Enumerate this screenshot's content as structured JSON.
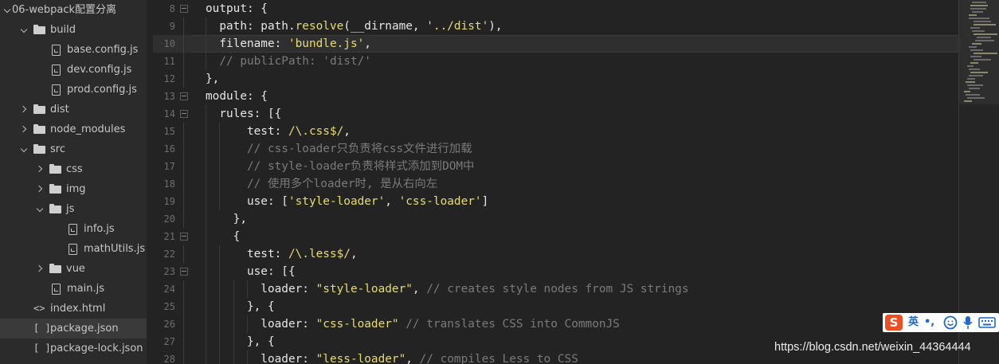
{
  "sidebar": {
    "items": [
      {
        "label": "06-webpack配置分离",
        "type": "folder",
        "state": "open"
      },
      {
        "label": "build",
        "type": "folder",
        "state": "open"
      },
      {
        "label": "base.config.js",
        "type": "file"
      },
      {
        "label": "dev.config.js",
        "type": "file"
      },
      {
        "label": "prod.config.js",
        "type": "file"
      },
      {
        "label": "dist",
        "type": "folder",
        "state": "closed"
      },
      {
        "label": "node_modules",
        "type": "folder",
        "state": "closed"
      },
      {
        "label": "src",
        "type": "folder",
        "state": "open"
      },
      {
        "label": "css",
        "type": "folder",
        "state": "closed"
      },
      {
        "label": "img",
        "type": "folder",
        "state": "closed"
      },
      {
        "label": "js",
        "type": "folder",
        "state": "open"
      },
      {
        "label": "info.js",
        "type": "file"
      },
      {
        "label": "mathUtils.js",
        "type": "file"
      },
      {
        "label": "vue",
        "type": "folder",
        "state": "closed"
      },
      {
        "label": "main.js",
        "type": "file"
      },
      {
        "label": "index.html",
        "type": "html-file",
        "icon_text": "<>"
      },
      {
        "label": "package.json",
        "type": "json-file",
        "icon_text": "[ ]",
        "selected": true
      },
      {
        "label": "package-lock.json",
        "type": "json-file",
        "icon_text": "[ ]"
      }
    ]
  },
  "editor": {
    "current_line": "10",
    "lines": [
      {
        "num": "8",
        "fold": "open",
        "tokens": [
          {
            "t": "output: {",
            "c": "p"
          }
        ]
      },
      {
        "num": "9",
        "tokens": [
          {
            "t": "  path: path.",
            "c": "p"
          },
          {
            "t": "resolve",
            "c": "fn"
          },
          {
            "t": "(__dirname, ",
            "c": "p"
          },
          {
            "t": "'../dist'",
            "c": "str"
          },
          {
            "t": "),",
            "c": "p"
          }
        ]
      },
      {
        "num": "10",
        "tokens": [
          {
            "t": "  filename: ",
            "c": "p"
          },
          {
            "t": "'bundle.js'",
            "c": "str"
          },
          {
            "t": ",",
            "c": "p"
          }
        ]
      },
      {
        "num": "11",
        "tokens": [
          {
            "t": "  // publicPath: 'dist/'",
            "c": "com"
          }
        ]
      },
      {
        "num": "12",
        "tokens": [
          {
            "t": "},",
            "c": "p"
          }
        ]
      },
      {
        "num": "13",
        "fold": "open",
        "tokens": [
          {
            "t": "module: {",
            "c": "p"
          }
        ]
      },
      {
        "num": "14",
        "fold": "open",
        "tokens": [
          {
            "t": "  rules: [{",
            "c": "p"
          }
        ]
      },
      {
        "num": "15",
        "tokens": [
          {
            "t": "      test: ",
            "c": "p"
          },
          {
            "t": "/\\.css$/",
            "c": "str"
          },
          {
            "t": ",",
            "c": "p"
          }
        ]
      },
      {
        "num": "16",
        "tokens": [
          {
            "t": "      // css-loader只负责将css文件进行加载",
            "c": "com"
          }
        ]
      },
      {
        "num": "17",
        "tokens": [
          {
            "t": "      // style-loader负责将样式添加到DOM中",
            "c": "com"
          }
        ]
      },
      {
        "num": "18",
        "tokens": [
          {
            "t": "      // 使用多个loader时, 是从右向左",
            "c": "com"
          }
        ]
      },
      {
        "num": "19",
        "tokens": [
          {
            "t": "      use: [",
            "c": "p"
          },
          {
            "t": "'style-loader'",
            "c": "str"
          },
          {
            "t": ", ",
            "c": "p"
          },
          {
            "t": "'css-loader'",
            "c": "str"
          },
          {
            "t": "]",
            "c": "p"
          }
        ]
      },
      {
        "num": "20",
        "tokens": [
          {
            "t": "    },",
            "c": "p"
          }
        ]
      },
      {
        "num": "21",
        "fold": "open",
        "tokens": [
          {
            "t": "    {",
            "c": "p"
          }
        ]
      },
      {
        "num": "22",
        "tokens": [
          {
            "t": "      test: ",
            "c": "p"
          },
          {
            "t": "/\\.less$/",
            "c": "str"
          },
          {
            "t": ",",
            "c": "p"
          }
        ]
      },
      {
        "num": "23",
        "fold": "open",
        "tokens": [
          {
            "t": "      use: [{",
            "c": "p"
          }
        ]
      },
      {
        "num": "24",
        "tokens": [
          {
            "t": "        loader: ",
            "c": "p"
          },
          {
            "t": "\"style-loader\"",
            "c": "str"
          },
          {
            "t": ", ",
            "c": "p"
          },
          {
            "t": "// creates style nodes from JS strings",
            "c": "com"
          }
        ]
      },
      {
        "num": "25",
        "tokens": [
          {
            "t": "      }, {",
            "c": "p"
          }
        ]
      },
      {
        "num": "26",
        "tokens": [
          {
            "t": "        loader: ",
            "c": "p"
          },
          {
            "t": "\"css-loader\"",
            "c": "str"
          },
          {
            "t": " ",
            "c": "p"
          },
          {
            "t": "// translates CSS into CommonJS",
            "c": "com"
          }
        ]
      },
      {
        "num": "27",
        "tokens": [
          {
            "t": "      }, {",
            "c": "p"
          }
        ]
      },
      {
        "num": "28",
        "tokens": [
          {
            "t": "        loader: ",
            "c": "p"
          },
          {
            "t": "\"less-loader\"",
            "c": "str"
          },
          {
            "t": ", ",
            "c": "p"
          },
          {
            "t": "// compiles Less to CSS",
            "c": "com"
          }
        ]
      }
    ]
  },
  "ime": {
    "logo": "S",
    "lang": "英",
    "punct": "•,",
    "emoji_icon": "smiley-icon",
    "mic_icon": "microphone-icon",
    "keyboard_icon": "keyboard-icon"
  },
  "watermark": "https://blog.csdn.net/weixin_44364444",
  "colors": {
    "editor_bg": "#232323",
    "sidebar_bg": "#2b2b2b",
    "string": "#e6db74",
    "comment": "#7a7a7a",
    "plain": "#e6e6e6",
    "ime_logo": "#ec4f24"
  }
}
